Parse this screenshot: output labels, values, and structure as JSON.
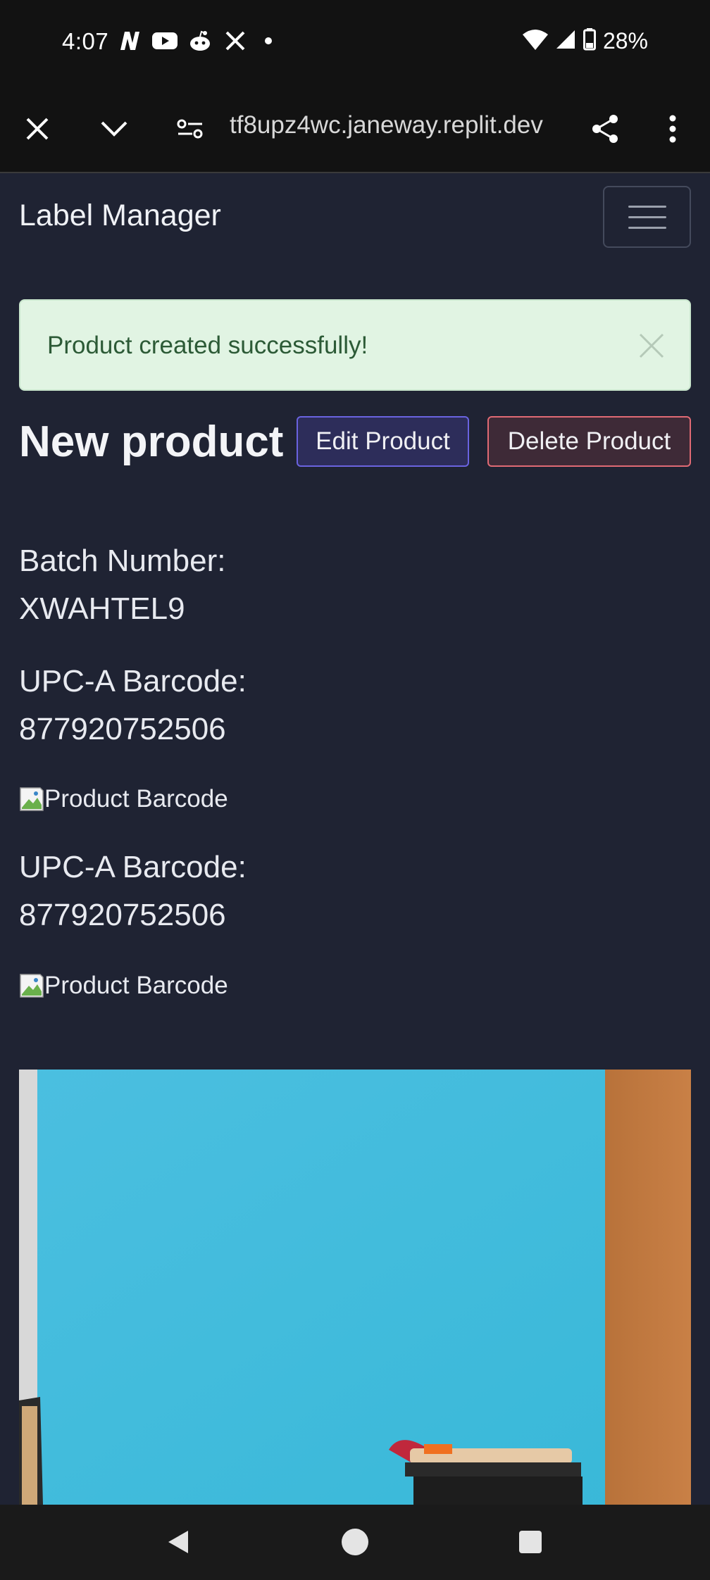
{
  "status_bar": {
    "time": "4:07",
    "battery": "28%",
    "left_icons": [
      "n-app-icon",
      "youtube-icon",
      "reddit-icon",
      "x-icon"
    ],
    "right_icons": [
      "wifi-icon",
      "signal-icon",
      "battery-icon"
    ]
  },
  "browser": {
    "url": "tf8upz4wc.janeway.replit.dev"
  },
  "navbar": {
    "brand": "Label Manager"
  },
  "alert": {
    "message": "Product created successfully!",
    "color": "#e1f4e3"
  },
  "product": {
    "title": "New product",
    "edit_label": "Edit Product",
    "delete_label": "Delete Product",
    "batch_label": "Batch Number:",
    "batch_value": "XWAHTEL9",
    "barcodes": [
      {
        "label": "UPC-A Barcode:",
        "value": "877920752506",
        "img_alt": "Product Barcode"
      },
      {
        "label": "UPC-A Barcode:",
        "value": "877920752506",
        "img_alt": "Product Barcode"
      }
    ]
  },
  "colors": {
    "page_bg": "#1f2333",
    "edit_border": "#6a63e0",
    "delete_border": "#e06a74"
  }
}
